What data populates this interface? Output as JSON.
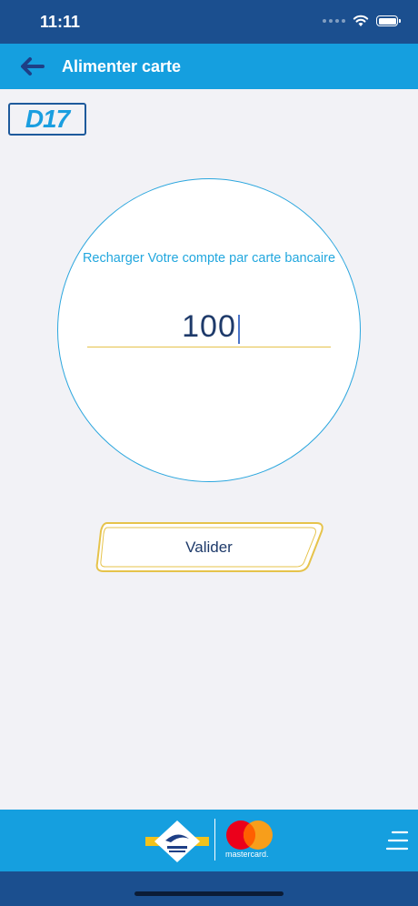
{
  "status_bar": {
    "time": "11:11"
  },
  "header": {
    "title": "Alimenter carte"
  },
  "logo": {
    "text": "D17"
  },
  "recharge": {
    "prompt": "Recharger Votre compte par carte bancaire",
    "amount_value": "100"
  },
  "actions": {
    "validate_label": "Valider"
  },
  "footer": {
    "mastercard_label": "mastercard."
  },
  "colors": {
    "status_bar": "#1b4f8f",
    "nav_bar": "#159fdf",
    "accent_blue": "#22a7de",
    "gold": "#e6c34b",
    "text_dark": "#1e3a6a",
    "mastercard_red": "#eb001b",
    "mastercard_orange": "#f79e1b"
  }
}
